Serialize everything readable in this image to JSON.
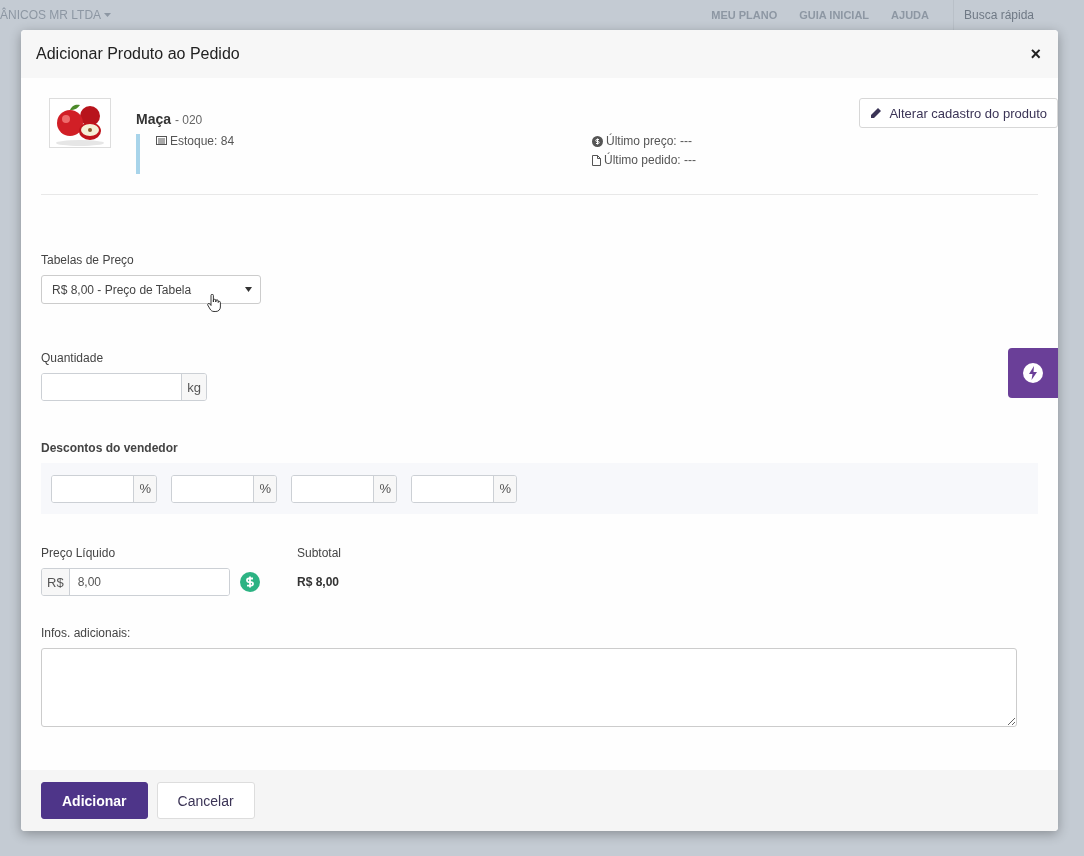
{
  "top_bar": {
    "company": "ÂNICOS MR LTDA",
    "links": [
      "MEU PLANO",
      "GUIA INICIAL",
      "AJUDA"
    ],
    "search": {
      "placeholder": "Busca rápida"
    }
  },
  "modal": {
    "title": "Adicionar Produto ao Pedido",
    "close": "×",
    "product": {
      "name": "Maça",
      "code": "- 020",
      "stock": "Estoque: 84",
      "last_price": "Último preço: ---",
      "last_order": "Último pedido: ---",
      "edit_button": "Alterar cadastro do produto"
    },
    "price_table": {
      "label": "Tabelas de Preço",
      "value": "R$ 8,00 - Preço de Tabela"
    },
    "quantity": {
      "label": "Quantidade",
      "unit": "kg"
    },
    "discounts": {
      "label": "Descontos do vendedor",
      "fields": [
        {
          "unit": "%"
        },
        {
          "unit": "%"
        },
        {
          "unit": "%"
        },
        {
          "unit": "%"
        }
      ]
    },
    "net_price": {
      "label": "Preço Líquido",
      "prefix": "R$",
      "value": "8,00"
    },
    "subtotal": {
      "label": "Subtotal",
      "value": "R$ 8,00"
    },
    "notes": {
      "label": "Infos. adicionais:"
    },
    "buttons": [
      {
        "label": "Adicionar",
        "kind": "primary"
      },
      {
        "label": "Cancelar",
        "kind": "secondary"
      }
    ]
  }
}
